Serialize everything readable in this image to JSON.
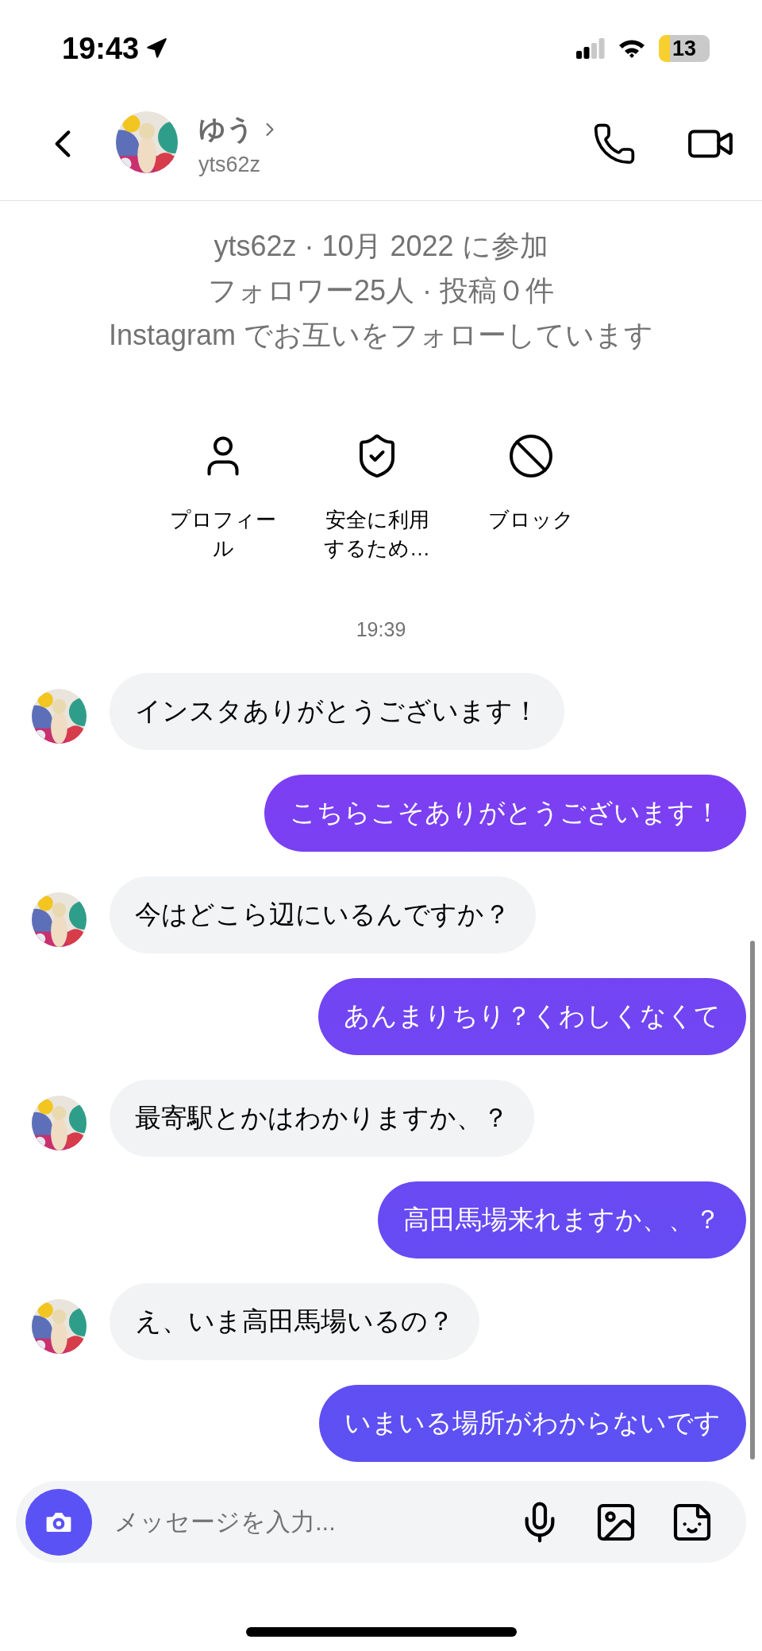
{
  "status_bar": {
    "time": "19:43",
    "battery": "13"
  },
  "header": {
    "name": "ゆう",
    "username": "yts62z"
  },
  "profile": {
    "lines": [
      "yts62z · 10月 2022 に参加",
      "フォロワー25人 · 投稿０件",
      "Instagram でお互いをフォローしています"
    ]
  },
  "actions": [
    {
      "kind": "profile",
      "label": "プロフィール"
    },
    {
      "kind": "safety",
      "label": "安全に利用するため…"
    },
    {
      "kind": "block",
      "label": "ブロック"
    }
  ],
  "timestamp": "19:39",
  "messages": [
    {
      "kind": "received",
      "text": "インスタありがとうございます！"
    },
    {
      "kind": "sent",
      "text": "こちらこそありがとうございます！"
    },
    {
      "kind": "received",
      "text": "今はどこら辺にいるんですか？"
    },
    {
      "kind": "sent",
      "text": "あんまりちり？くわしくなくて"
    },
    {
      "kind": "received",
      "text": "最寄駅とかはわかりますか、？"
    },
    {
      "kind": "sent",
      "text": "高田馬場来れますか、、？"
    },
    {
      "kind": "received",
      "text": "え、いま高田馬場いるの？"
    },
    {
      "kind": "sent",
      "text": "いまいる場所がわからないです"
    }
  ],
  "composer": {
    "placeholder": "メッセージを入力..."
  }
}
